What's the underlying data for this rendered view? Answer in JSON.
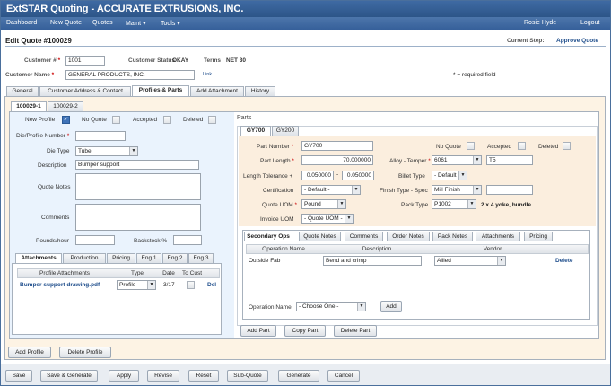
{
  "app": {
    "title": "ExtSTAR Quoting - ACCURATE EXTRUSIONS, INC.",
    "user": "Rosie Hyde",
    "logout": "Logout"
  },
  "menu": [
    "Dashboard",
    "New Quote",
    "Quotes",
    "Maint",
    "Tools"
  ],
  "header": {
    "edit_title": "Edit Quote #100029",
    "current_step_label": "Current Step:",
    "current_step": "Approve Quote"
  },
  "customer": {
    "num_label": "Customer #",
    "num": "1001",
    "status_label": "Customer Status",
    "status": "OKAY",
    "terms_label": "Terms",
    "terms": "NET 30",
    "name_label": "Customer Name",
    "name": "GENERAL PRODUCTS, INC.",
    "link": "Link",
    "required_note": "* = required field"
  },
  "main_tabs": [
    "General",
    "Customer Address & Contact",
    "Profiles & Parts",
    "Add Attachment",
    "History"
  ],
  "profile_tabs": [
    "100029-1",
    "100029-2"
  ],
  "profile": {
    "new_profile": "New Profile",
    "no_quote": "No Quote",
    "accepted": "Accepted",
    "deleted": "Deleted",
    "die_profile_label": "Die/Profile Number",
    "die_profile": "",
    "die_type_label": "Die Type",
    "die_type": "Tube",
    "description_label": "Description",
    "description": "Bumper support",
    "quote_notes_label": "Quote Notes",
    "comments_label": "Comments",
    "pounds_label": "Pounds/hour",
    "backstock_label": "Backstock %"
  },
  "attach_tabs": [
    "Attachments",
    "Production",
    "Pricing",
    "Eng 1",
    "Eng 2",
    "Eng 3"
  ],
  "attach_table": {
    "headers": [
      "Profile Attachments",
      "Type",
      "Date",
      "To Cust"
    ],
    "row": {
      "name": "Bumper support drawing.pdf",
      "type": "Profile",
      "date": "3/17",
      "del": "Del"
    }
  },
  "parts": {
    "title": "Parts",
    "tabs": [
      "GY700",
      "GY200"
    ],
    "part_number_label": "Part Number",
    "part_number": "GY700",
    "no_quote": "No Quote",
    "accepted": "Accepted",
    "deleted": "Deleted",
    "length_label": "Part Length",
    "length": "70.000000",
    "alloy_label": "Alloy - Temper",
    "alloy": "6061",
    "temper": "T5",
    "tol_label": "Length Tolerance +",
    "tol_plus": "0.050000",
    "tol_minus": "0.050000",
    "billet_label": "Billet Type",
    "billet": "- Default -",
    "cert_label": "Certification",
    "cert": "- Default -",
    "finish_label": "Finish Type - Spec",
    "finish": "Mill Finish",
    "quote_uom_label": "Quote UOM",
    "quote_uom": "Pound",
    "pack_label": "Pack Type",
    "pack": "P1002",
    "pack_desc": "2 x 4 yoke, bundle...",
    "invoice_uom_label": "Invoice UOM",
    "invoice_uom": "- Quote UOM -"
  },
  "ops_tabs": [
    "Secondary Ops",
    "Quote Notes",
    "Comments",
    "Order Notes",
    "Pack Notes",
    "Attachments",
    "Pricing"
  ],
  "ops_table": {
    "headers": [
      "Operation Name",
      "Description",
      "Vendor"
    ],
    "row": {
      "op": "Outside Fab",
      "desc": "Bend and crimp",
      "vendor": "Allied",
      "delete": "Delete"
    }
  },
  "ops_add": {
    "label": "Operation Name",
    "value": "- Choose One -",
    "button": "Add"
  },
  "part_buttons": [
    "Add Part",
    "Copy Part",
    "Delete Part"
  ],
  "profile_buttons": [
    "Add Profile",
    "Delete Profile"
  ],
  "footer_buttons": [
    "Save",
    "Save & Generate",
    "Apply",
    "Revise",
    "Reset",
    "Sub-Quote",
    "Generate",
    "Cancel"
  ],
  "colors": {
    "title_bar": "#2d5588",
    "accent": "#1f4e8c",
    "parts_panel": "#fbeede"
  }
}
